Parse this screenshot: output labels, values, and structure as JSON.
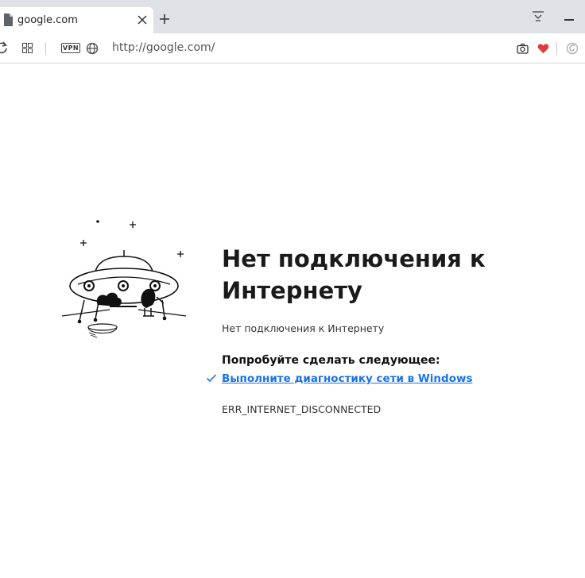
{
  "tab": {
    "title": "google.com"
  },
  "toolbar": {
    "vpn_label": "VPN",
    "url": "http://google.com/"
  },
  "error": {
    "title": "Нет подключения к Интернету",
    "subtitle": "Нет подключения к Интернету",
    "try_heading": "Попробуйте сделать следующее:",
    "suggestion_link": "Выполните диагностику сети в Windows",
    "code": "ERR_INTERNET_DISCONNECTED"
  },
  "colors": {
    "link": "#1a73e8",
    "heart": "#e53935",
    "tabbar": "#dee1e6"
  },
  "icons": [
    "file-icon",
    "close-icon",
    "plus-icon",
    "tab-menu-icon",
    "minimize-icon",
    "reload-icon",
    "speed-dial-icon",
    "vpn-badge",
    "globe-icon",
    "camera-icon",
    "heart-icon",
    "aria-icon",
    "checkmark-icon",
    "ufo-illustration"
  ]
}
